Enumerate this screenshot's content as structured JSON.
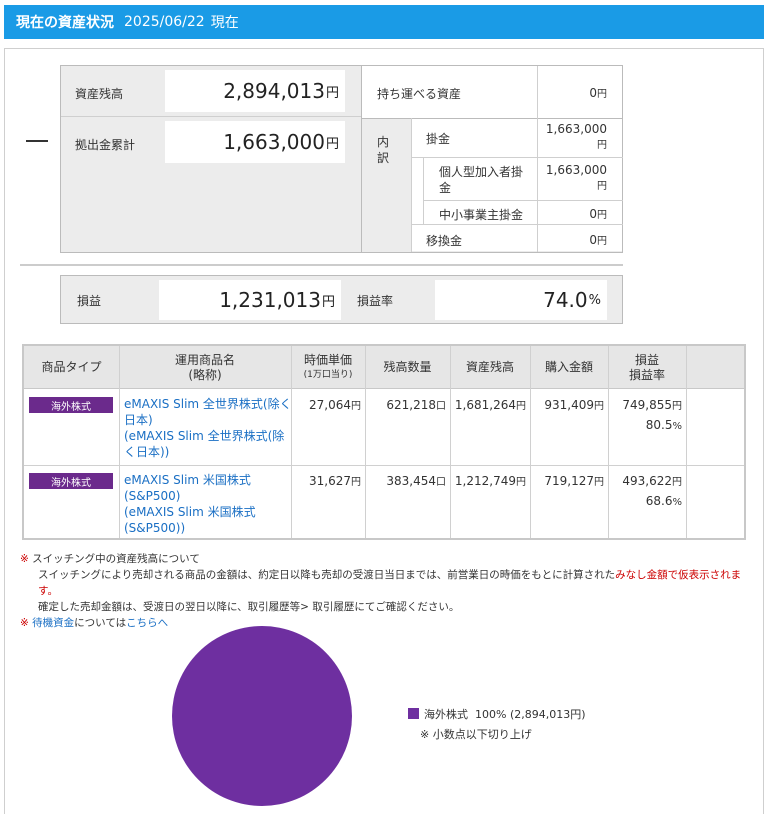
{
  "header": {
    "title": "現在の資産状況",
    "date": "2025/06/22",
    "suffix": "現在"
  },
  "summary": {
    "asset_balance_label": "資産残高",
    "asset_balance_value": "2,894,013",
    "contribution_total_label": "拠出金累計",
    "contribution_total_value": "1,663,000",
    "yen": "円",
    "portable_label": "持ち運べる資産",
    "portable_value": "0",
    "breakdown_label": "内\n訳",
    "contribution_label": "掛金",
    "contribution_value": "1,663,000",
    "individual_label": "個人型加入者掛金",
    "individual_value": "1,663,000",
    "sme_label": "中小事業主掛金",
    "sme_value": "0",
    "transfer_label": "移換金",
    "transfer_value": "0"
  },
  "profit": {
    "label": "損益",
    "value": "1,231,013",
    "rate_label": "損益率",
    "rate_value": "74.0",
    "pct": "%"
  },
  "table": {
    "headers": {
      "type": "商品タイプ",
      "name": "運用商品名",
      "name_sub": "(略称)",
      "price": "時価単価",
      "price_sub": "(1万口当り)",
      "qty": "残高数量",
      "balance": "資産残高",
      "purchase": "購入金額",
      "pl": "損益",
      "pl_rate": "損益率"
    },
    "unit_yen": "円",
    "unit_kuchi": "口",
    "unit_pct": "%",
    "rows": [
      {
        "type": "海外株式",
        "name1": "eMAXIS Slim 全世界株式(除く日本)",
        "name2": "(eMAXIS Slim 全世界株式(除く日本))",
        "price": "27,064",
        "qty": "621,218",
        "balance": "1,681,264",
        "purchase": "931,409",
        "pl": "749,855",
        "rate": "80.5"
      },
      {
        "type": "海外株式",
        "name1": "eMAXIS Slim 米国株式(S&P500)",
        "name2": "(eMAXIS Slim 米国株式(S&P500))",
        "price": "31,627",
        "qty": "383,454",
        "balance": "1,212,749",
        "purchase": "719,127",
        "pl": "493,622",
        "rate": "68.6"
      }
    ]
  },
  "notes": {
    "mark": "※",
    "title": "スイッチング中の資産残高について",
    "line1a": "スイッチングにより売却される商品の金額は、約定日以降も売却の受渡日当日までは、前営業日の時価をもとに計算された",
    "line1b": "みなし金額で仮表示されます。",
    "line2": "確定した売却金額は、受渡日の翌日以降に、取引履歴等> 取引履歴にてご確認ください。",
    "link1": "待機資金",
    "line3": "については",
    "link2": "こちらへ"
  },
  "chart_data": {
    "type": "pie",
    "categories": [
      "海外株式"
    ],
    "values": [
      100
    ],
    "colors": [
      "#6e2fa0"
    ],
    "legend": [
      {
        "label": "海外株式",
        "pct": "100%",
        "amount": "(2,894,013円)"
      }
    ],
    "note": "※ 小数点以下切り上げ"
  }
}
